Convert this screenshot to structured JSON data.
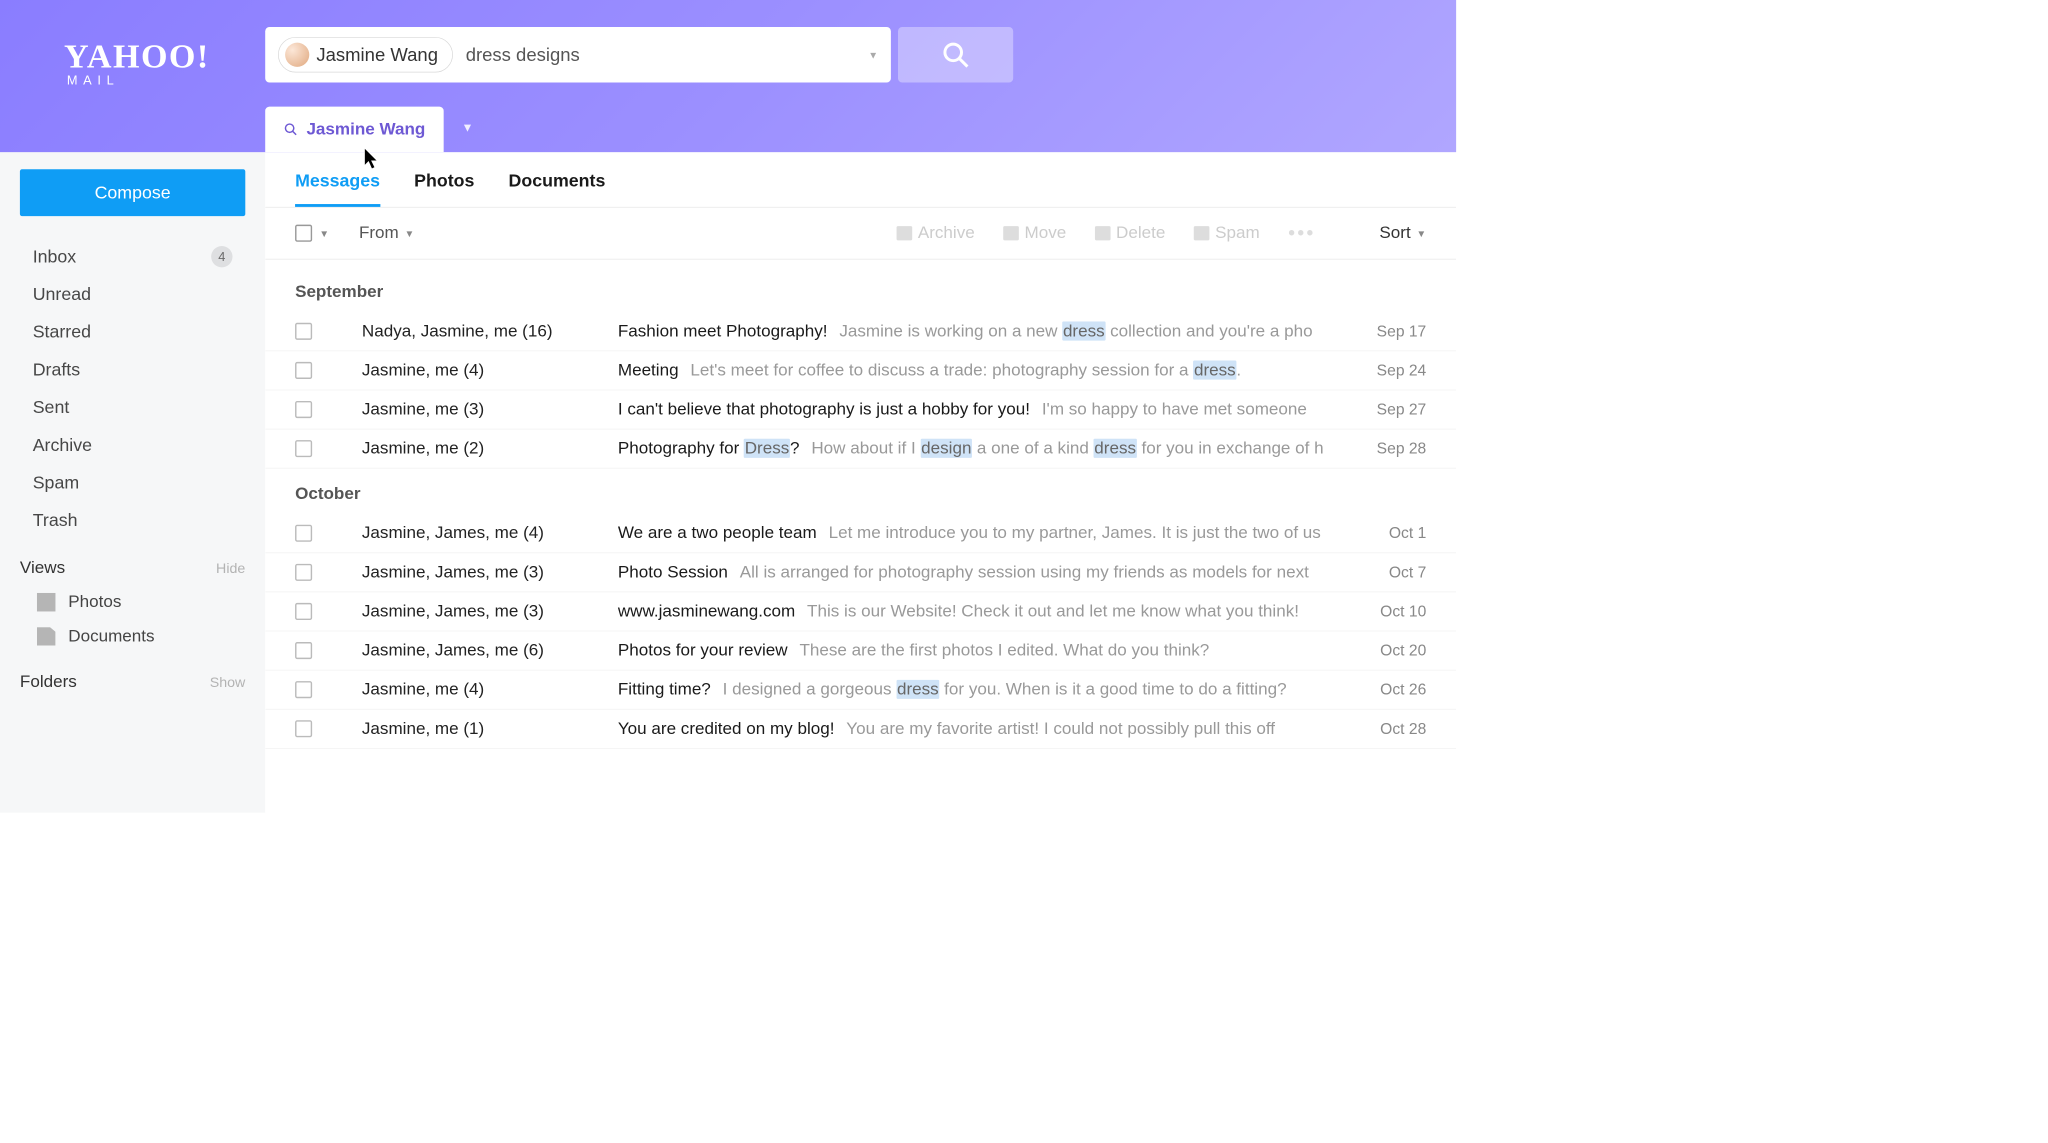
{
  "logo": {
    "brand": "YAHOO!",
    "sub": "MAIL"
  },
  "search": {
    "chip_name": "Jasmine Wang",
    "query": "dress designs"
  },
  "filter_tab": "Jasmine Wang",
  "sidebar": {
    "compose": "Compose",
    "items": [
      {
        "label": "Inbox",
        "count": "4"
      },
      {
        "label": "Unread"
      },
      {
        "label": "Starred"
      },
      {
        "label": "Drafts"
      },
      {
        "label": "Sent"
      },
      {
        "label": "Archive"
      },
      {
        "label": "Spam"
      },
      {
        "label": "Trash"
      }
    ],
    "views_label": "Views",
    "views_action": "Hide",
    "views": [
      {
        "label": "Photos"
      },
      {
        "label": "Documents"
      }
    ],
    "folders_label": "Folders",
    "folders_action": "Show"
  },
  "tabs": [
    {
      "label": "Messages",
      "active": true
    },
    {
      "label": "Photos"
    },
    {
      "label": "Documents"
    }
  ],
  "toolbar": {
    "from": "From",
    "archive": "Archive",
    "move": "Move",
    "delete": "Delete",
    "spam": "Spam",
    "sort": "Sort"
  },
  "groups": [
    {
      "title": "September",
      "messages": [
        {
          "from": "Nadya, Jasmine, me (16)",
          "subject": "Fashion meet Photography!",
          "preview": "Jasmine is working on a new |dress| collection and you're a pho",
          "date": "Sep 17"
        },
        {
          "from": "Jasmine, me (4)",
          "subject": "Meeting",
          "preview": "Let's meet for coffee to discuss a trade: photography session for a |dress|.",
          "date": "Sep 24"
        },
        {
          "from": "Jasmine, me (3)",
          "subject": "I can't believe that photography is just a hobby for you!",
          "preview": "I'm so happy to have met someone",
          "date": "Sep 27"
        },
        {
          "from": "Jasmine, me (2)",
          "subject": "Photography for |Dress|?",
          "preview": "How about if I |design| a one of a kind |dress| for you in exchange of h",
          "date": "Sep 28"
        }
      ]
    },
    {
      "title": "October",
      "messages": [
        {
          "from": "Jasmine, James, me (4)",
          "subject": "We are a two people team",
          "preview": "Let me introduce you to my partner, James. It is just the two of us",
          "date": "Oct 1"
        },
        {
          "from": "Jasmine, James, me (3)",
          "subject": "Photo Session",
          "preview": "All is arranged for photography session using my friends as models for next",
          "date": "Oct 7"
        },
        {
          "from": "Jasmine, James, me (3)",
          "subject": "www.jasminewang.com",
          "preview": "This is our Website! Check it out and let me know what you think!",
          "date": "Oct 10"
        },
        {
          "from": "Jasmine, James, me (6)",
          "subject": "Photos for your review",
          "preview": "These are the first photos I edited. What do you think?",
          "date": "Oct 20"
        },
        {
          "from": "Jasmine, me (4)",
          "subject": "Fitting time?",
          "preview": "I designed a gorgeous |dress| for you. When is it a good time to do a fitting?",
          "date": "Oct 26"
        },
        {
          "from": "Jasmine, me (1)",
          "subject": "You are credited on my blog!",
          "preview": "You are my favorite artist! I could not possibly pull this off",
          "date": "Oct 28"
        }
      ]
    }
  ]
}
